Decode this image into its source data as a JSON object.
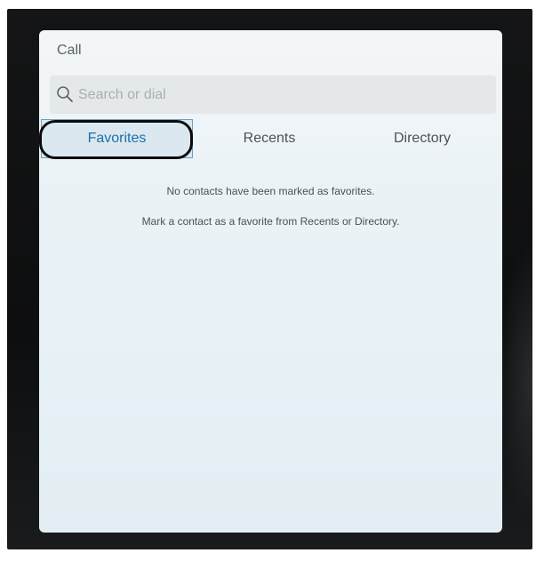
{
  "call": {
    "title": "Call",
    "search": {
      "placeholder": "Search or dial",
      "value": ""
    },
    "tabs": [
      {
        "label": "Favorites",
        "selected": true
      },
      {
        "label": "Recents",
        "selected": false
      },
      {
        "label": "Directory",
        "selected": false
      }
    ],
    "empty_state": {
      "line1": "No contacts have been marked as favorites.",
      "line2": "Mark a contact as a favorite from Recents or Directory."
    }
  },
  "icons": {
    "search": "search-icon"
  },
  "colors": {
    "selected_tab_text": "#1f6fa8",
    "selected_tab_bg": "#dbe8f0",
    "device_frame": "#141516",
    "highlight_ring": "#0b0b0b"
  }
}
